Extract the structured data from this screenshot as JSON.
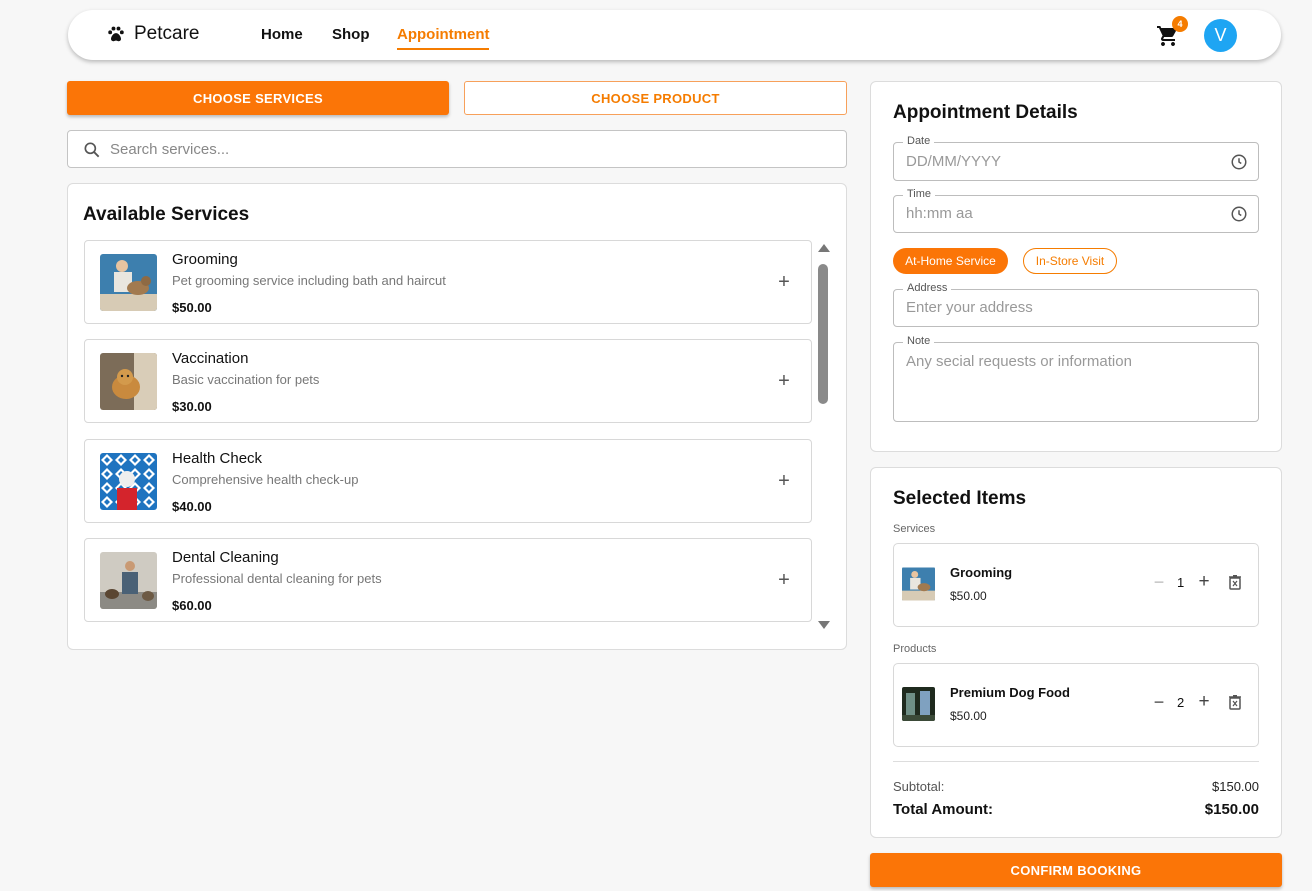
{
  "nav": {
    "brand": "Petcare",
    "links": [
      "Home",
      "Shop",
      "Appointment"
    ],
    "active_link": "Appointment",
    "cart_count": "4",
    "avatar_initial": "V"
  },
  "tabs": {
    "services_label": "CHOOSE SERVICES",
    "product_label": "CHOOSE PRODUCT"
  },
  "search": {
    "placeholder": "Search services..."
  },
  "services": {
    "title": "Available Services",
    "items": [
      {
        "name": "Grooming",
        "description": "Pet grooming service including bath and haircut",
        "price": "$50.00"
      },
      {
        "name": "Vaccination",
        "description": "Basic vaccination for pets",
        "price": "$30.00"
      },
      {
        "name": "Health Check",
        "description": "Comprehensive health check-up",
        "price": "$40.00"
      },
      {
        "name": "Dental Cleaning",
        "description": "Professional dental cleaning for pets",
        "price": "$60.00"
      }
    ]
  },
  "appointment": {
    "title": "Appointment Details",
    "date": {
      "label": "Date",
      "placeholder": "DD/MM/YYYY"
    },
    "time": {
      "label": "Time",
      "placeholder": "hh:mm aa"
    },
    "options": [
      "At-Home Service",
      "In-Store Visit"
    ],
    "selected_option": "At-Home Service",
    "address": {
      "label": "Address",
      "placeholder": "Enter your address"
    },
    "note": {
      "label": "Note",
      "placeholder": "Any secial requests or information"
    }
  },
  "selected": {
    "title": "Selected Items",
    "services_label": "Services",
    "products_label": "Products",
    "services": [
      {
        "name": "Grooming",
        "price": "$50.00",
        "qty": "1"
      }
    ],
    "products": [
      {
        "name": "Premium Dog Food",
        "price": "$50.00",
        "qty": "2"
      }
    ],
    "subtotal_label": "Subtotal:",
    "subtotal": "$150.00",
    "total_label": "Total Amount:",
    "total": "$150.00"
  },
  "confirm_label": "CONFIRM BOOKING",
  "colors": {
    "accent": "#fb7507",
    "avatar": "#1ea5f3"
  }
}
